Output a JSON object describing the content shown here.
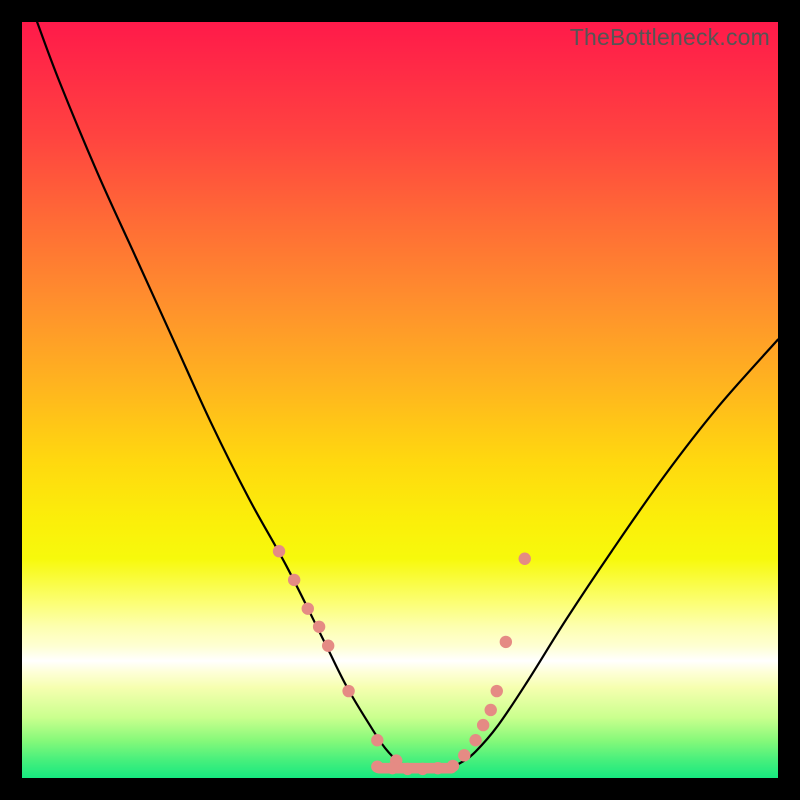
{
  "watermark": "TheBottleneck.com",
  "chart_data": {
    "type": "line",
    "title": "",
    "xlabel": "",
    "ylabel": "",
    "xlim": [
      0,
      100
    ],
    "ylim": [
      0,
      100
    ],
    "grid": false,
    "series": [
      {
        "name": "bottleneck-curve",
        "color": "#000000",
        "x": [
          2,
          5,
          10,
          15,
          20,
          25,
          30,
          35,
          40,
          43,
          46,
          48,
          50,
          52,
          54,
          56,
          58,
          60,
          63,
          67,
          72,
          78,
          85,
          92,
          100
        ],
        "y": [
          100,
          92,
          80,
          69,
          58,
          47,
          37,
          28,
          18,
          12,
          7,
          4,
          2,
          1.2,
          1,
          1.2,
          2,
          3.5,
          7,
          13,
          21,
          30,
          40,
          49,
          58
        ]
      }
    ],
    "markers": [
      {
        "name": "left-cluster",
        "color": "#e58b84",
        "x": [
          34.0,
          36.0,
          37.8,
          39.3,
          40.5,
          43.2,
          47.0,
          49.5
        ],
        "y": [
          30.0,
          26.2,
          22.4,
          20.0,
          17.5,
          11.5,
          5.0,
          2.3
        ]
      },
      {
        "name": "bottom-band",
        "color": "#e58b84",
        "x": [
          47.0,
          49.0,
          51.0,
          53.0,
          55.0,
          57.0
        ],
        "y": [
          1.5,
          1.3,
          1.2,
          1.2,
          1.3,
          1.6
        ]
      },
      {
        "name": "right-cluster",
        "color": "#e58b84",
        "x": [
          58.5,
          60.0,
          61.0,
          62.0,
          62.8,
          64.0,
          66.5
        ],
        "y": [
          3.0,
          5.0,
          7.0,
          9.0,
          11.5,
          18.0,
          29.0
        ]
      }
    ],
    "bottom_band": {
      "color": "#e58b84",
      "x0": 46.5,
      "x1": 57.5,
      "y": 1.3,
      "height_pct": 1.4
    }
  }
}
